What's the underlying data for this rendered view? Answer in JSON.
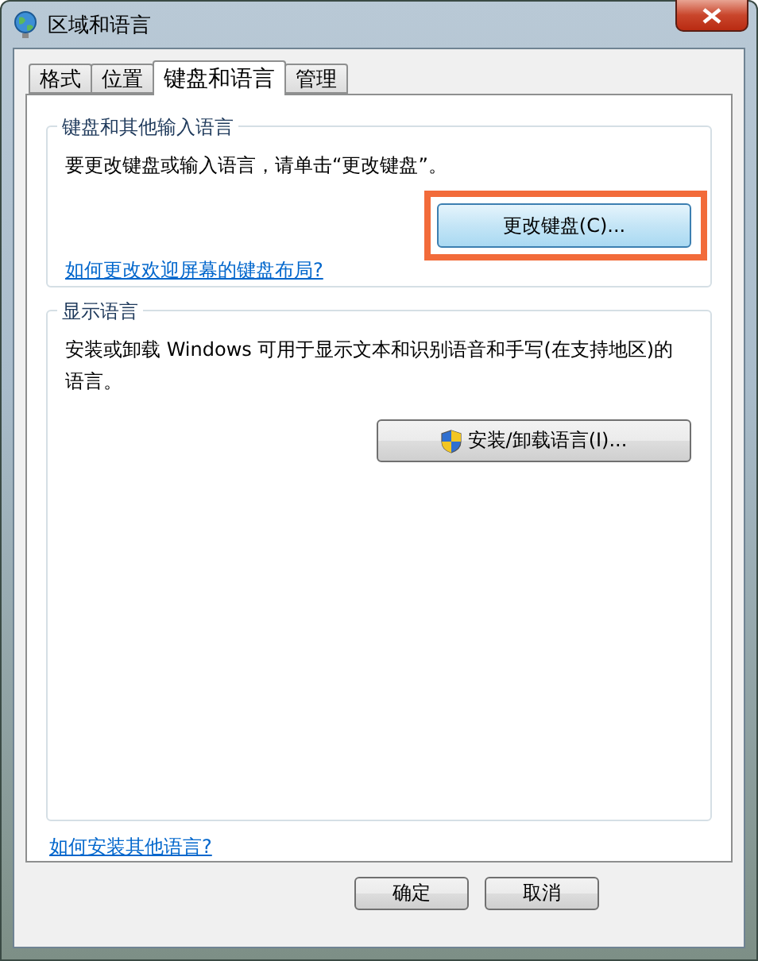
{
  "window": {
    "title": "区域和语言"
  },
  "tabs": [
    {
      "label": "格式",
      "selected": false
    },
    {
      "label": "位置",
      "selected": false
    },
    {
      "label": "键盘和语言",
      "selected": true
    },
    {
      "label": "管理",
      "selected": false
    }
  ],
  "keyboard_group": {
    "title": "键盘和其他输入语言",
    "description": "要更改键盘或输入语言，请单击“更改键盘”。",
    "button": {
      "label": "更改键盘(C)...",
      "highlighted": true
    },
    "link": "如何更改欢迎屏幕的键盘布局?"
  },
  "display_group": {
    "title": "显示语言",
    "description": "安装或卸载 Windows 可用于显示文本和识别语音和手写(在支持地区)的语言。",
    "button": {
      "label": "安装/卸载语言(I)..."
    }
  },
  "bottom_link": "如何安装其他语言?",
  "buttons": [
    "确定",
    "取消"
  ]
}
